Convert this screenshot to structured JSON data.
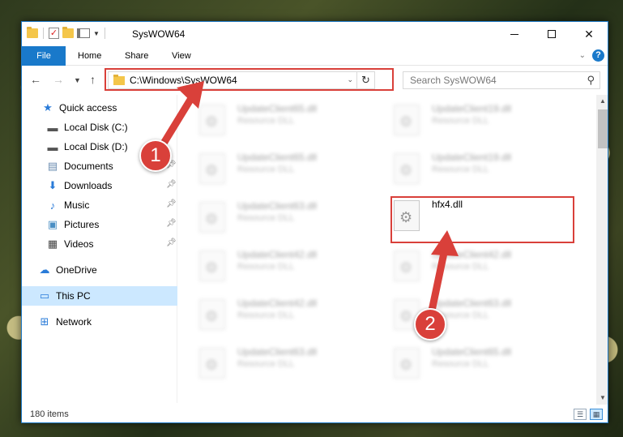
{
  "window": {
    "title": "SysWOW64"
  },
  "ribbon": {
    "tabs": [
      {
        "label": "File"
      },
      {
        "label": "Home"
      },
      {
        "label": "Share"
      },
      {
        "label": "View"
      }
    ]
  },
  "address": {
    "path": "C:\\Windows\\SysWOW64"
  },
  "search": {
    "placeholder": "Search SysWOW64"
  },
  "nav": {
    "items": [
      {
        "label": "Quick access",
        "icon": "star-icon"
      },
      {
        "label": "Local Disk (C:)",
        "icon": "drive-icon"
      },
      {
        "label": "Local Disk (D:)",
        "icon": "drive-icon"
      },
      {
        "label": "Documents",
        "icon": "documents-icon"
      },
      {
        "label": "Downloads",
        "icon": "download-icon"
      },
      {
        "label": "Music",
        "icon": "music-icon"
      },
      {
        "label": "Pictures",
        "icon": "pictures-icon"
      },
      {
        "label": "Videos",
        "icon": "videos-icon"
      },
      {
        "label": "OneDrive",
        "icon": "cloud-icon"
      },
      {
        "label": "This PC",
        "icon": "computer-icon",
        "selected": true
      },
      {
        "label": "Network",
        "icon": "network-icon"
      }
    ]
  },
  "files": [
    {
      "name": "UpdateClient65.dll",
      "type": "Resource DLL"
    },
    {
      "name": "UpdateClient19.dll",
      "type": "Resource DLL"
    },
    {
      "name": "UpdateClient65.dll",
      "type": "Resource DLL"
    },
    {
      "name": "UpdateClient19.dll",
      "type": "Resource DLL"
    },
    {
      "name": "UpdateClient63.dll",
      "type": "Resource DLL"
    },
    {
      "name": "hfx4.dll",
      "type": ""
    },
    {
      "name": "UpdateClient42.dll",
      "type": "Resource DLL"
    },
    {
      "name": "UpdateClient42.dll",
      "type": "Resource DLL"
    },
    {
      "name": "UpdateClient42.dll",
      "type": "Resource DLL"
    },
    {
      "name": "UpdateClient63.dll",
      "type": "Resource DLL"
    },
    {
      "name": "UpdateClient63.dll",
      "type": "Resource DLL"
    },
    {
      "name": "UpdateClient65.dll",
      "type": "Resource DLL"
    }
  ],
  "status": {
    "count": "180 items"
  },
  "callouts": [
    {
      "label": "1"
    },
    {
      "label": "2"
    }
  ],
  "colors": {
    "accent": "#1979ca",
    "highlight": "#d9403a",
    "selected": "#cce8ff"
  }
}
